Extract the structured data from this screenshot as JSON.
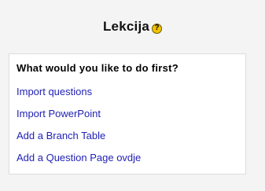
{
  "header": {
    "title": "Lekcija",
    "help_icon_glyph": "?"
  },
  "panel": {
    "question": "What would you like to do first?",
    "options": [
      {
        "label": "Import questions"
      },
      {
        "label": "Import PowerPoint"
      },
      {
        "label": "Add a Branch Table"
      },
      {
        "label": "Add a Question Page ovdje"
      }
    ]
  },
  "colors": {
    "background": "#f4f4f4",
    "panel_background": "#ffffff",
    "panel_border": "#dddddd",
    "link": "#1f1fb5",
    "help_icon": "#f3c200"
  },
  "icons": {
    "help": "help-icon"
  }
}
